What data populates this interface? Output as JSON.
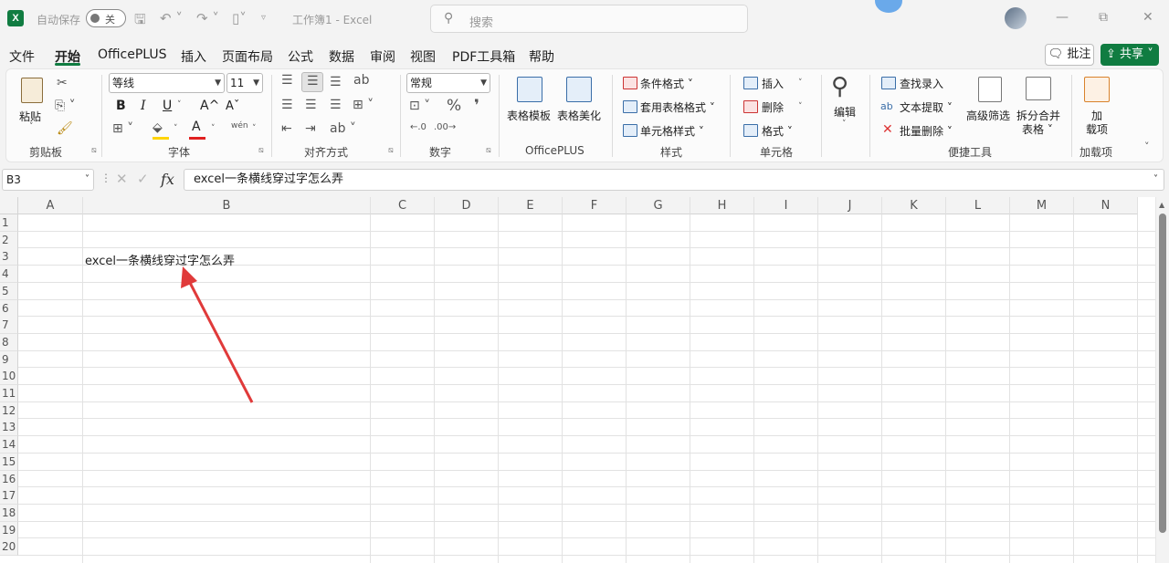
{
  "titlebar": {
    "logo": "X",
    "autosave_label": "自动保存",
    "autosave_state": "关",
    "filename": "工作簿1 - Excel",
    "search_placeholder": "搜索",
    "minimize": "—",
    "restore": "⧉",
    "close": "✕"
  },
  "menu": {
    "items": [
      "文件",
      "开始",
      "OfficePLUS",
      "插入",
      "页面布局",
      "公式",
      "数据",
      "审阅",
      "视图",
      "PDF工具箱",
      "帮助"
    ],
    "active": "开始",
    "comment_label": "批注",
    "share_label": "共享"
  },
  "ribbon": {
    "clipboard": {
      "paste": "粘贴",
      "group": "剪贴板"
    },
    "font": {
      "name": "等线",
      "size": "11",
      "bold": "B",
      "italic": "I",
      "underline": "U",
      "grow": "A^",
      "shrink": "Aˇ",
      "wen": "wén",
      "group": "字体"
    },
    "align": {
      "group": "对齐方式"
    },
    "number": {
      "format": "常规",
      "percent": "%",
      "comma": "❜",
      "group": "数字"
    },
    "officeplus": {
      "table_template": "表格模板",
      "table_beautify": "表格美化",
      "group": "OfficePLUS"
    },
    "styles": {
      "conditional": "条件格式",
      "table_format": "套用表格格式",
      "cell_style": "单元格样式",
      "group": "样式"
    },
    "cells": {
      "insert": "插入",
      "delete": "删除",
      "format": "格式",
      "group": "单元格"
    },
    "editing": {
      "edit": "编辑"
    },
    "quicktools": {
      "find_entry": "查找录入",
      "text_extract": "文本提取",
      "batch_delete": "批量删除",
      "advanced_filter": "高级筛选",
      "split_merge_1": "拆分合并",
      "split_merge_2": "表格",
      "group": "便捷工具"
    },
    "addins": {
      "label_1": "加",
      "label_2": "载项",
      "group": "加载项"
    }
  },
  "formula_bar": {
    "name_box": "B3",
    "fx": "fx",
    "content": "excel一条横线穿过字怎么弄"
  },
  "sheet": {
    "columns": [
      "A",
      "B",
      "C",
      "D",
      "E",
      "F",
      "G",
      "H",
      "I",
      "J",
      "K",
      "L",
      "M",
      "N"
    ],
    "rows": [
      "1",
      "2",
      "3",
      "4",
      "5",
      "6",
      "7",
      "8",
      "9",
      "10",
      "11",
      "12",
      "13",
      "14",
      "15",
      "16",
      "17",
      "18",
      "19",
      "20"
    ],
    "cell_B3": "excel一条横线穿过字怎么弄",
    "annotation_arrow_color": "#e03a3a"
  }
}
